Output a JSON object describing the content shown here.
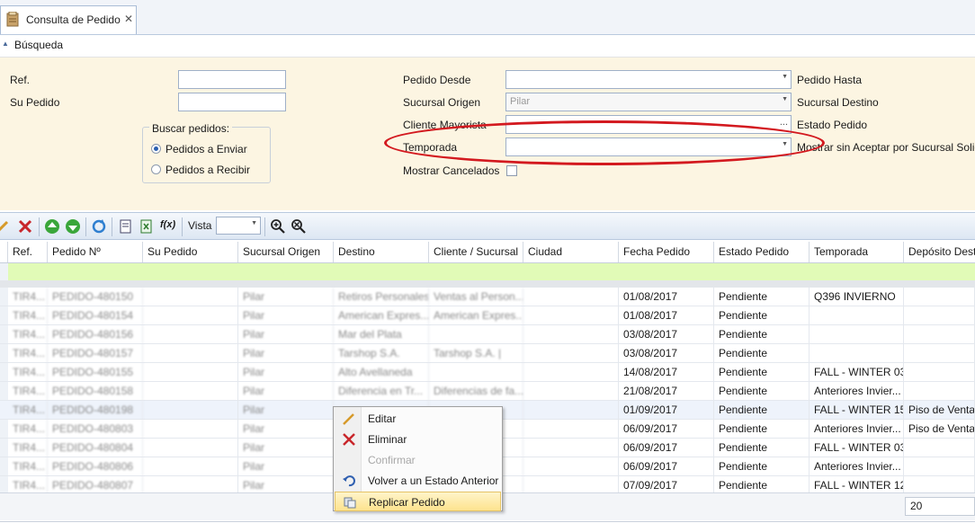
{
  "tab": {
    "title": "Consulta de Pedido",
    "close": "✕"
  },
  "group": {
    "title": "Búsqueda"
  },
  "search": {
    "ref_label": "Ref.",
    "su_pedido_label": "Su Pedido",
    "buscar_legend": "Buscar pedidos:",
    "radio_enviar": "Pedidos a Enviar",
    "radio_recibir": "Pedidos a Recibir",
    "radio_selected": "Pedidos a Enviar",
    "pedido_desde_label": "Pedido Desde",
    "sucursal_origen_label": "Sucursal Origen",
    "sucursal_origen_value": "Pilar",
    "cliente_mayorista_label": "Cliente Mayorista",
    "temporada_label": "Temporada",
    "mostrar_cancelados_label": "Mostrar Cancelados",
    "pedido_hasta_label": "Pedido Hasta",
    "sucursal_destino_label": "Sucursal Destino",
    "estado_pedido_label": "Estado Pedido",
    "mostrar_sin_aceptar_label": "Mostrar sin Aceptar por Sucursal Solic",
    "ellipsis": "..."
  },
  "toolbar": {
    "vista_label": "Vista",
    "fx_label": "f(x)"
  },
  "grid": {
    "columns": [
      "Ref.",
      "Pedido Nº",
      "Su Pedido",
      "Sucursal Origen",
      "Destino",
      "Cliente / Sucursal",
      "Ciudad",
      "Fecha Pedido",
      "Estado Pedido",
      "Temporada",
      "Depósito Dest"
    ],
    "rows": [
      {
        "ref": "TIR4...",
        "pedido": "PEDIDO-480150",
        "origen": "Pilar",
        "destino": "Retiros Personales",
        "cliente": "Ventas al Person...",
        "fecha": "01/08/2017",
        "estado": "Pendiente",
        "temporada": "Q396 INVIERNO",
        "deposito": ""
      },
      {
        "ref": "TIR4...",
        "pedido": "PEDIDO-480154",
        "origen": "Pilar",
        "destino": "American Expres...",
        "cliente": "American Expres...",
        "fecha": "01/08/2017",
        "estado": "Pendiente",
        "temporada": "",
        "deposito": ""
      },
      {
        "ref": "TIR4...",
        "pedido": "PEDIDO-480156",
        "origen": "Pilar",
        "destino": "Mar del Plata",
        "cliente": "",
        "fecha": "03/08/2017",
        "estado": "Pendiente",
        "temporada": "",
        "deposito": ""
      },
      {
        "ref": "TIR4...",
        "pedido": "PEDIDO-480157",
        "origen": "Pilar",
        "destino": "Tarshop S.A.",
        "cliente": "Tarshop S.A. |",
        "fecha": "03/08/2017",
        "estado": "Pendiente",
        "temporada": "",
        "deposito": ""
      },
      {
        "ref": "TIR4...",
        "pedido": "PEDIDO-480155",
        "origen": "Pilar",
        "destino": "Alto Avellaneda",
        "cliente": "",
        "fecha": "14/08/2017",
        "estado": "Pendiente",
        "temporada": "FALL - WINTER 03",
        "deposito": ""
      },
      {
        "ref": "TIR4...",
        "pedido": "PEDIDO-480158",
        "origen": "Pilar",
        "destino": "Diferencia en Tr...",
        "cliente": "Diferencias de fa...",
        "fecha": "21/08/2017",
        "estado": "Pendiente",
        "temporada": "Anteriores Invier...",
        "deposito": ""
      },
      {
        "ref": "TIR4...",
        "pedido": "PEDIDO-480198",
        "origen": "Pilar",
        "destino": "",
        "cliente": "",
        "fecha": "01/09/2017",
        "estado": "Pendiente",
        "temporada": "FALL - WINTER 15",
        "deposito": "Piso de Venta"
      },
      {
        "ref": "TIR4...",
        "pedido": "PEDIDO-480803",
        "origen": "Pilar",
        "destino": "",
        "cliente": "",
        "fecha": "06/09/2017",
        "estado": "Pendiente",
        "temporada": "Anteriores Invier...",
        "deposito": "Piso de Venta"
      },
      {
        "ref": "TIR4...",
        "pedido": "PEDIDO-480804",
        "origen": "Pilar",
        "destino": "",
        "cliente": "",
        "fecha": "06/09/2017",
        "estado": "Pendiente",
        "temporada": "FALL - WINTER 03",
        "deposito": ""
      },
      {
        "ref": "TIR4...",
        "pedido": "PEDIDO-480806",
        "origen": "Pilar",
        "destino": "",
        "cliente": "",
        "fecha": "06/09/2017",
        "estado": "Pendiente",
        "temporada": "Anteriores Invier...",
        "deposito": ""
      },
      {
        "ref": "TIR4...",
        "pedido": "PEDIDO-480807",
        "origen": "Pilar",
        "destino": "",
        "cliente": "",
        "fecha": "07/09/2017",
        "estado": "Pendiente",
        "temporada": "FALL - WINTER 12",
        "deposito": ""
      }
    ],
    "page_size": "20"
  },
  "context_menu": {
    "items": [
      {
        "label": "Editar",
        "icon": "pencil-icon",
        "enabled": true
      },
      {
        "label": "Eliminar",
        "icon": "delete-x-icon",
        "enabled": true
      },
      {
        "label": "Confirmar",
        "icon": "",
        "enabled": false
      },
      {
        "label": "Volver a un Estado Anterior",
        "icon": "undo-icon",
        "enabled": true
      },
      {
        "label": "Replicar Pedido",
        "icon": "replicate-icon",
        "enabled": true
      }
    ],
    "highlighted": "Replicar Pedido"
  },
  "colors": {
    "panel_bg": "#fcf5e2",
    "filter_row": "#e1fbb7",
    "annotation_ellipse": "#d3191f",
    "menu_highlight": "#fde38e"
  }
}
